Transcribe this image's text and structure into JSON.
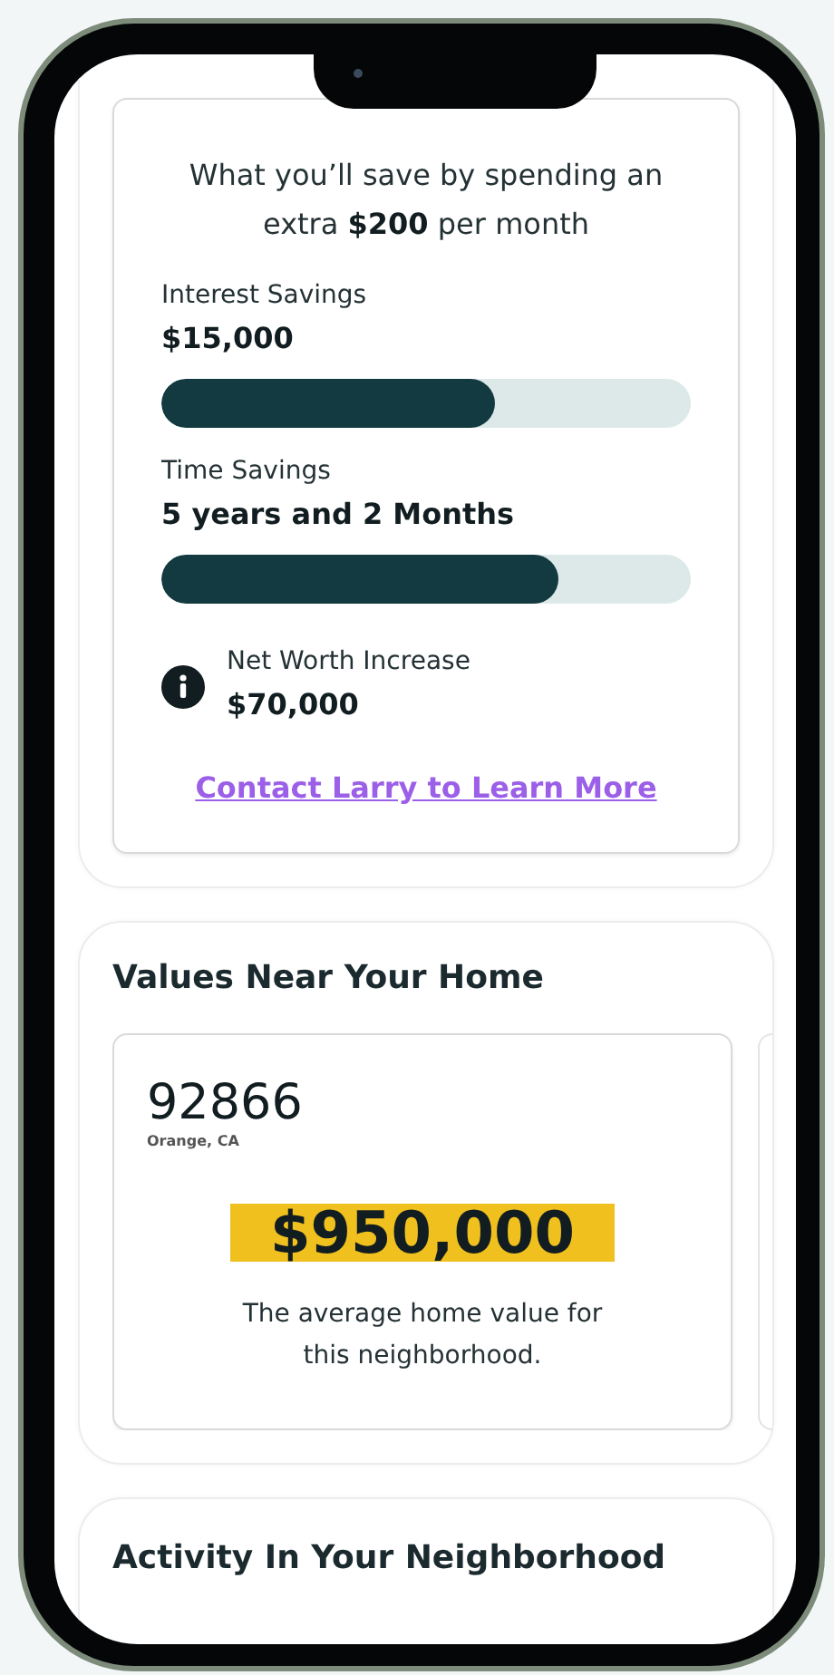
{
  "savings_card": {
    "heading": "What you’ll save by spending an extra **$200** per month",
    "metrics": [
      {
        "kind": "bar",
        "label": "Interest Savings",
        "value": "$15,000",
        "level": 0.63
      },
      {
        "kind": "bar",
        "label": "Time Savings",
        "value": "5 years and 2 Months",
        "level": 0.75
      },
      {
        "kind": "info",
        "label": "Net Worth Increase",
        "value": "$70,000"
      }
    ],
    "link": "Contact Larry to Learn More"
  },
  "values_section": {
    "title": "Values Near Your Home",
    "cards": [
      {
        "zip": "92866",
        "location": "Orange, CA",
        "price": "$950,000",
        "description": "The average home value for this neighborhood."
      }
    ]
  },
  "activity_section": {
    "title": "Activity In Your Neighborhood"
  }
}
